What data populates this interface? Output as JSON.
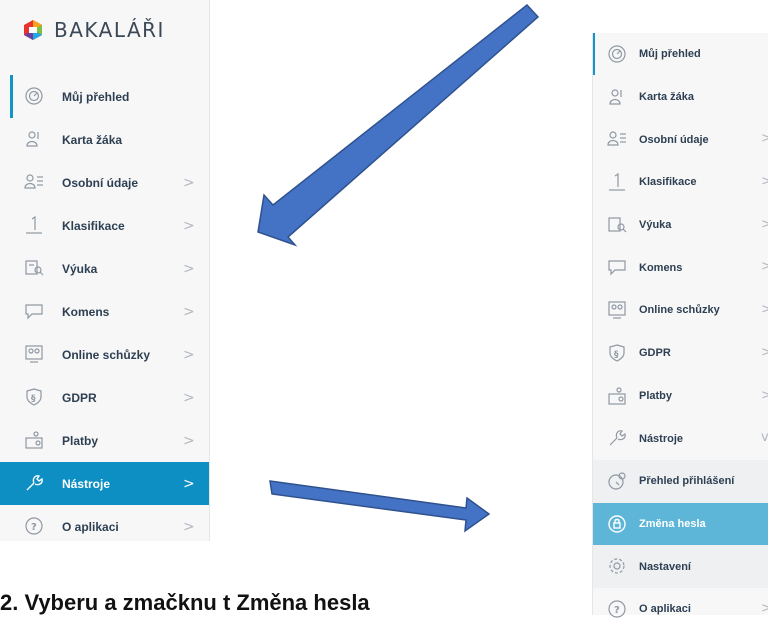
{
  "app": {
    "name": "BAKALÁŘI"
  },
  "left_menu": {
    "items": [
      {
        "label": "Můj přehled",
        "icon": "dashboard-icon"
      },
      {
        "label": "Karta žáka",
        "icon": "student-card-icon"
      },
      {
        "label": "Osobní údaje",
        "icon": "personal-data-icon"
      },
      {
        "label": "Klasifikace",
        "icon": "grade-icon"
      },
      {
        "label": "Výuka",
        "icon": "lesson-icon"
      },
      {
        "label": "Komens",
        "icon": "messages-icon"
      },
      {
        "label": "Online schůzky",
        "icon": "online-meeting-icon"
      },
      {
        "label": "GDPR",
        "icon": "gdpr-icon"
      },
      {
        "label": "Platby",
        "icon": "payments-icon"
      },
      {
        "label": "Nástroje",
        "icon": "tools-icon"
      },
      {
        "label": "O aplikaci",
        "icon": "about-icon"
      }
    ],
    "chevron": ">"
  },
  "right_menu": {
    "items": [
      {
        "label": "Můj přehled"
      },
      {
        "label": "Karta žáka"
      },
      {
        "label": "Osobní údaje"
      },
      {
        "label": "Klasifikace"
      },
      {
        "label": "Výuka"
      },
      {
        "label": "Komens"
      },
      {
        "label": "Online schůzky"
      },
      {
        "label": "GDPR"
      },
      {
        "label": "Platby"
      },
      {
        "label": "Nástroje"
      },
      {
        "label": "Přehled přihlášení"
      },
      {
        "label": "Změna hesla"
      },
      {
        "label": "Nastavení"
      },
      {
        "label": "O aplikaci"
      }
    ],
    "chevron": ">",
    "chevron_open": "v"
  },
  "caption": {
    "text": "2.   Vyberu a zmačknu t Změna hesla"
  },
  "colors": {
    "accent": "#0d8fc4",
    "accent_light": "#5db5d8",
    "arrow": "#3f6fc4",
    "text": "#2d3f52"
  }
}
